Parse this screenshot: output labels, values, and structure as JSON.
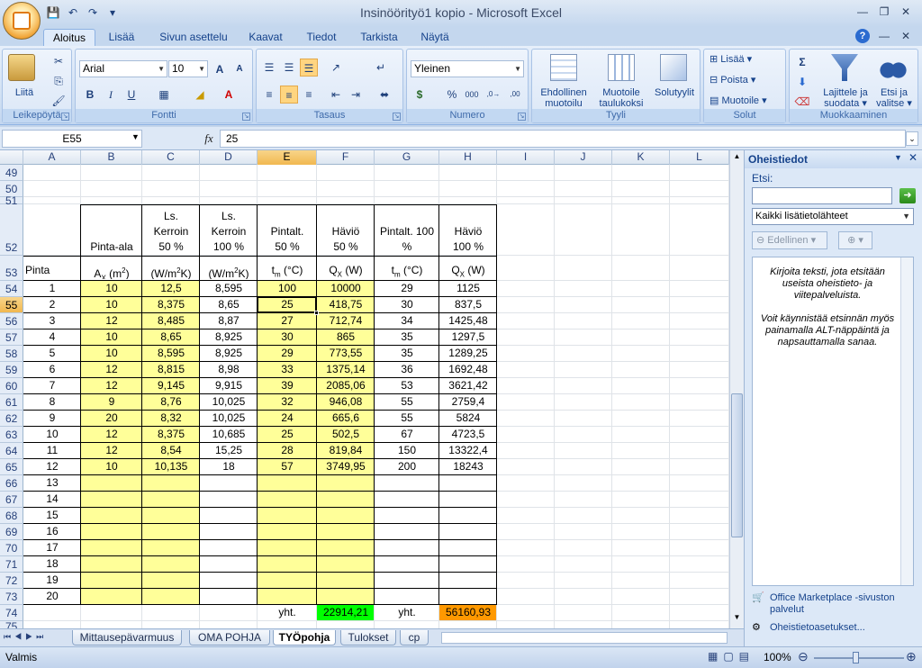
{
  "app": {
    "title": "Insinöörityö1 kopio - Microsoft Excel"
  },
  "qat": {
    "save": "💾",
    "undo": "↶",
    "redo": "↷",
    "customize": "▾"
  },
  "window": {
    "minimize": "—",
    "restore": "❐",
    "close": "✕"
  },
  "tabs": [
    "Aloitus",
    "Lisää",
    "Sivun asettelu",
    "Kaavat",
    "Tiedot",
    "Tarkista",
    "Näytä"
  ],
  "ribbon": {
    "clipboard": {
      "label": "Leikepöytä",
      "paste": "Liitä"
    },
    "font": {
      "label": "Fontti",
      "name": "Arial",
      "size": "10",
      "bold": "B",
      "italic": "I",
      "underline": "U",
      "grow": "A",
      "shrink": "A",
      "fill_icon": "◢",
      "font_color": "A"
    },
    "alignment": {
      "label": "Tasaus"
    },
    "number": {
      "label": "Numero",
      "format": "Yleinen",
      "currency": "$",
      "percent": "%",
      "thousands": "000",
      "dec_inc": ",0→",
      "dec_dec": ",00"
    },
    "styles": {
      "label": "Tyyli",
      "cond1": "Ehdollinen",
      "cond2": "muotoilu",
      "table1": "Muotoile",
      "table2": "taulukoksi",
      "cell1": "Solutyylit"
    },
    "cells": {
      "label": "Solut",
      "insert": "Lisää",
      "delete": "Poista",
      "format": "Muotoile"
    },
    "editing": {
      "label": "Muokkaaminen",
      "sum": "Σ",
      "fill": "⬇",
      "clear": "⌫",
      "sort1": "Lajittele ja",
      "sort2": "suodata",
      "find1": "Etsi ja",
      "find2": "valitse"
    }
  },
  "formula": {
    "namebox": "E55",
    "fx": "fx",
    "value": "25"
  },
  "columns": [
    "A",
    "B",
    "C",
    "D",
    "E",
    "F",
    "G",
    "H",
    "I",
    "J",
    "K",
    "L"
  ],
  "rows_top": [
    "49",
    "50",
    "51",
    "52",
    "53"
  ],
  "header52": {
    "b": "Pinta-ala",
    "c1": "Ls.",
    "c2": "Kerroin",
    "c3": "50 %",
    "d1": "Ls.",
    "d2": "Kerroin",
    "d3": "100 %",
    "e1": "Pintalt.",
    "e2": "50 %",
    "f1": "Häviö",
    "f2": "50 %",
    "g1": "Pintalt. 100",
    "g2": "%",
    "h1": "Häviö",
    "h2": "100 %"
  },
  "header53": {
    "a": "Pinta",
    "b": "A",
    "b_sub": "X",
    "b_tail": " (m",
    "b_sup": "2",
    "b_end": ")",
    "c": "(W/m",
    "c_sup": "2",
    "c_end": "K)",
    "d": "(W/m",
    "d_sup": "2",
    "d_end": "K)",
    "e": "t",
    "e_sub": "m",
    "e_tail": " (°C)",
    "f": "Q",
    "f_sub": "X",
    "f_tail": " (W)",
    "g": "t",
    "g_sub": "m",
    "g_tail": " (°C)",
    "h": "Q",
    "h_sub": "X",
    "h_tail": " (W)"
  },
  "table": {
    "rows": [
      {
        "row": "54",
        "a": "1",
        "b": "10",
        "c": "12,5",
        "d": "8,595",
        "e": "100",
        "f": "10000",
        "g": "29",
        "h": "1125"
      },
      {
        "row": "55",
        "a": "2",
        "b": "10",
        "c": "8,375",
        "d": "8,65",
        "e": "25",
        "f": "418,75",
        "g": "30",
        "h": "837,5"
      },
      {
        "row": "56",
        "a": "3",
        "b": "12",
        "c": "8,485",
        "d": "8,87",
        "e": "27",
        "f": "712,74",
        "g": "34",
        "h": "1425,48"
      },
      {
        "row": "57",
        "a": "4",
        "b": "10",
        "c": "8,65",
        "d": "8,925",
        "e": "30",
        "f": "865",
        "g": "35",
        "h": "1297,5"
      },
      {
        "row": "58",
        "a": "5",
        "b": "10",
        "c": "8,595",
        "d": "8,925",
        "e": "29",
        "f": "773,55",
        "g": "35",
        "h": "1289,25"
      },
      {
        "row": "59",
        "a": "6",
        "b": "12",
        "c": "8,815",
        "d": "8,98",
        "e": "33",
        "f": "1375,14",
        "g": "36",
        "h": "1692,48"
      },
      {
        "row": "60",
        "a": "7",
        "b": "12",
        "c": "9,145",
        "d": "9,915",
        "e": "39",
        "f": "2085,06",
        "g": "53",
        "h": "3621,42"
      },
      {
        "row": "61",
        "a": "8",
        "b": "9",
        "c": "8,76",
        "d": "10,025",
        "e": "32",
        "f": "946,08",
        "g": "55",
        "h": "2759,4"
      },
      {
        "row": "62",
        "a": "9",
        "b": "20",
        "c": "8,32",
        "d": "10,025",
        "e": "24",
        "f": "665,6",
        "g": "55",
        "h": "5824"
      },
      {
        "row": "63",
        "a": "10",
        "b": "12",
        "c": "8,375",
        "d": "10,685",
        "e": "25",
        "f": "502,5",
        "g": "67",
        "h": "4723,5"
      },
      {
        "row": "64",
        "a": "11",
        "b": "12",
        "c": "8,54",
        "d": "15,25",
        "e": "28",
        "f": "819,84",
        "g": "150",
        "h": "13322,4"
      },
      {
        "row": "65",
        "a": "12",
        "b": "10",
        "c": "10,135",
        "d": "18",
        "e": "57",
        "f": "3749,95",
        "g": "200",
        "h": "18243"
      },
      {
        "row": "66",
        "a": "13",
        "b": "",
        "c": "",
        "d": "",
        "e": "",
        "f": "",
        "g": "",
        "h": ""
      },
      {
        "row": "67",
        "a": "14",
        "b": "",
        "c": "",
        "d": "",
        "e": "",
        "f": "",
        "g": "",
        "h": ""
      },
      {
        "row": "68",
        "a": "15",
        "b": "",
        "c": "",
        "d": "",
        "e": "",
        "f": "",
        "g": "",
        "h": ""
      },
      {
        "row": "69",
        "a": "16",
        "b": "",
        "c": "",
        "d": "",
        "e": "",
        "f": "",
        "g": "",
        "h": ""
      },
      {
        "row": "70",
        "a": "17",
        "b": "",
        "c": "",
        "d": "",
        "e": "",
        "f": "",
        "g": "",
        "h": ""
      },
      {
        "row": "71",
        "a": "18",
        "b": "",
        "c": "",
        "d": "",
        "e": "",
        "f": "",
        "g": "",
        "h": ""
      },
      {
        "row": "72",
        "a": "19",
        "b": "",
        "c": "",
        "d": "",
        "e": "",
        "f": "",
        "g": "",
        "h": ""
      },
      {
        "row": "73",
        "a": "20",
        "b": "",
        "c": "",
        "d": "",
        "e": "",
        "f": "",
        "g": "",
        "h": ""
      }
    ]
  },
  "totals": {
    "row": "74",
    "e": "yht.",
    "f": "22914,21",
    "g": "yht.",
    "h": "56160,93",
    "row75": "75"
  },
  "colors": {
    "yellow": "#ffff99",
    "green": "#00ff00",
    "orange": "#ff9900"
  },
  "sheets": [
    "Mittausepävarmuus",
    "OMA POHJA",
    "TYÖpohja",
    "Tulokset",
    "cp"
  ],
  "pane": {
    "title": "Oheistiedot",
    "search_label": "Etsi:",
    "search_value": "",
    "source": "Kaikki lisätietolähteet",
    "prev": "Edellinen",
    "hint1": "Kirjoita teksti, jota etsitään useista oheistieto- ja viitepalveluista.",
    "hint2": "Voit käynnistää etsinnän myös painamalla ALT-näppäintä ja napsauttamalla sanaa.",
    "link1": "Office Marketplace -sivuston palvelut",
    "link2": "Oheistietoasetukset..."
  },
  "status": {
    "ready": "Valmis",
    "zoom": "100%"
  }
}
